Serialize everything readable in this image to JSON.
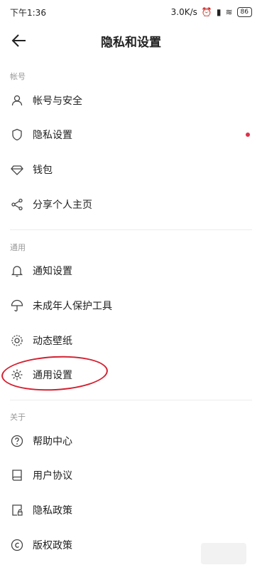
{
  "status_bar": {
    "time": "下午1:36",
    "speed": "3.0K/s",
    "battery": "86"
  },
  "header": {
    "title": "隐私和设置"
  },
  "sections": [
    {
      "label": "帐号",
      "items": [
        {
          "label": "帐号与安全",
          "icon": "person-icon"
        },
        {
          "label": "隐私设置",
          "icon": "shield-icon"
        },
        {
          "label": "钱包",
          "icon": "diamond-icon"
        },
        {
          "label": "分享个人主页",
          "icon": "share-icon"
        }
      ]
    },
    {
      "label": "通用",
      "items": [
        {
          "label": "通知设置",
          "icon": "bell-icon"
        },
        {
          "label": "未成年人保护工具",
          "icon": "umbrella-icon"
        },
        {
          "label": "动态壁纸",
          "icon": "wallpaper-icon"
        },
        {
          "label": "通用设置",
          "icon": "gear-icon"
        }
      ]
    },
    {
      "label": "关于",
      "items": [
        {
          "label": "帮助中心",
          "icon": "help-icon"
        },
        {
          "label": "用户协议",
          "icon": "book-icon"
        },
        {
          "label": "隐私政策",
          "icon": "lock-doc-icon"
        },
        {
          "label": "版权政策",
          "icon": "copyright-icon"
        }
      ]
    }
  ],
  "colors": {
    "annotation": "#d42030",
    "badge": "#e0304a"
  }
}
